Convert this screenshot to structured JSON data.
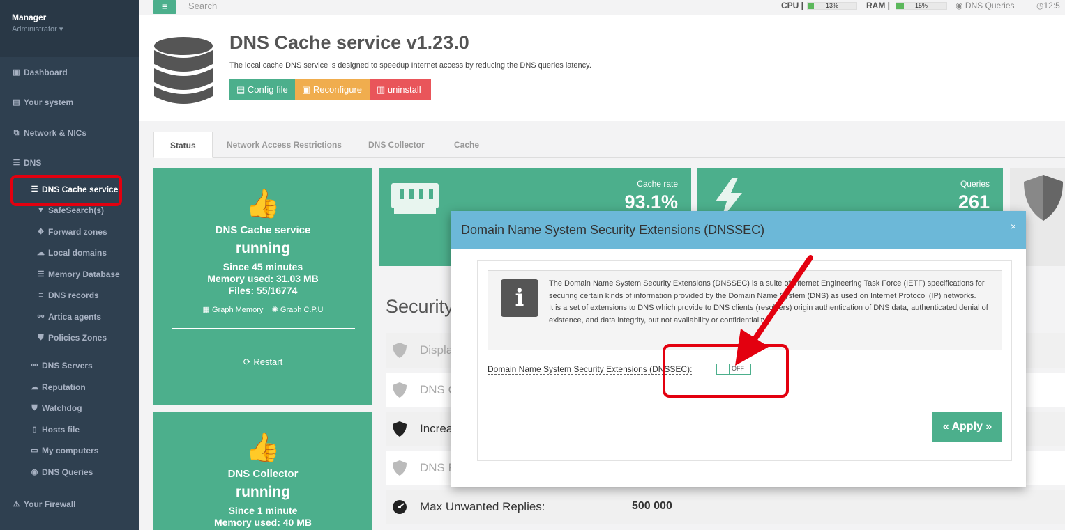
{
  "sidebar": {
    "user": "Manager",
    "role": "Administrator ▾",
    "items": [
      {
        "label": "Dashboard"
      },
      {
        "label": "Your system"
      },
      {
        "label": "Network & NICs"
      },
      {
        "label": "DNS"
      },
      {
        "label": "DNS Cache service"
      },
      {
        "label": "SafeSearch(s)"
      },
      {
        "label": "Forward zones"
      },
      {
        "label": "Local domains"
      },
      {
        "label": "Memory Database"
      },
      {
        "label": "DNS records"
      },
      {
        "label": "Artica agents"
      },
      {
        "label": "Policies Zones"
      },
      {
        "label": "DNS Servers"
      },
      {
        "label": "Reputation"
      },
      {
        "label": "Watchdog"
      },
      {
        "label": "Hosts file"
      },
      {
        "label": "My computers"
      },
      {
        "label": "DNS Queries"
      },
      {
        "label": "Your Firewall"
      }
    ]
  },
  "topbar": {
    "search_placeholder": "Search",
    "cpu_label": "CPU",
    "cpu_value": "13%",
    "cpu_fraction": 0.13,
    "ram_label": "RAM",
    "ram_value": "15%",
    "ram_fraction": 0.15,
    "dns_queries": "DNS Queries",
    "time": "12:5"
  },
  "header": {
    "title": "DNS Cache service v1.23.0",
    "description": "The local cache DNS service is designed to speedup Internet access by reducing the DNS queries latency.",
    "btn_config": "Config file",
    "btn_reconfigure": "Reconfigure",
    "btn_uninstall": "uninstall"
  },
  "tabs": [
    "Status",
    "Network Access Restrictions",
    "DNS Collector",
    "Cache"
  ],
  "service_card": {
    "title": "DNS Cache service",
    "status": "running",
    "since": "Since 45 minutes",
    "memory": "Memory used: 31.03 MB",
    "files": "Files: 55/16774",
    "graph_memory": "Graph Memory",
    "graph_cpu": "Graph C.P.U",
    "restart": "Restart"
  },
  "collector_card": {
    "title": "DNS Collector",
    "status": "running",
    "since": "Since 1 minute",
    "memory": "Memory used: 40 MB"
  },
  "stats": {
    "cache_rate_label": "Cache rate",
    "cache_rate_value": "93.1%",
    "queries_label": "Queries",
    "queries_value": "261"
  },
  "security": {
    "title": "Security",
    "rows": [
      {
        "label": "Displa"
      },
      {
        "label": "DNS Q"
      },
      {
        "label": "Increa"
      },
      {
        "label": "DNS R"
      },
      {
        "label": "Max Unwanted Replies:",
        "value": "500 000"
      }
    ]
  },
  "modal": {
    "title": "Domain Name System Security Extensions (DNSSEC)",
    "close": "×",
    "info_line1": "The Domain Name System Security Extensions (DNSSEC) is a suite of Internet Engineering Task Force (IETF) specifications for securing certain kinds of information provided by the Domain Name System (DNS) as used on Internet Protocol (IP) networks.",
    "info_line2": "It is a set of extensions to DNS which provide to DNS clients (resolvers) origin authentication of DNS data, authenticated denial of existence, and data integrity, but not availability or confidentiality.",
    "field_label": "Domain Name System Security Extensions (DNSSEC):",
    "toggle_state": "OFF",
    "apply": "« Apply »"
  },
  "colors": {
    "sidebar_bg": "#2f4050",
    "accent_green": "#4caf8c",
    "modal_header": "#6cb8d8",
    "highlight_red": "#e3000f"
  }
}
